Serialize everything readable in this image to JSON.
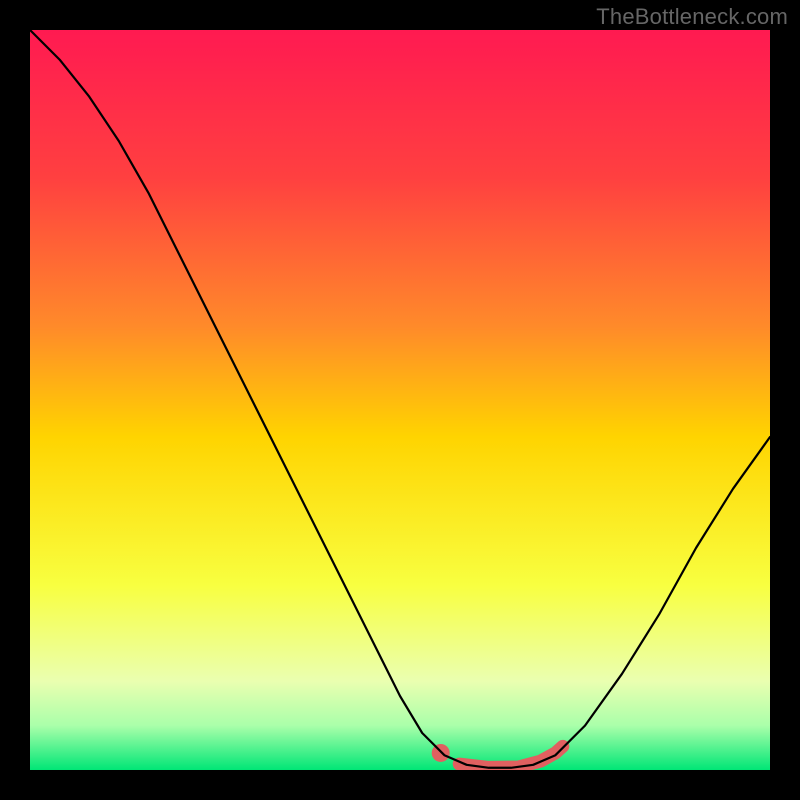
{
  "watermark": "TheBottleneck.com",
  "chart_data": {
    "type": "line",
    "title": "",
    "xlabel": "",
    "ylabel": "",
    "xlim": [
      0,
      100
    ],
    "ylim": [
      0,
      100
    ],
    "gradient_stops": [
      {
        "offset": 0,
        "color": "#ff1a51"
      },
      {
        "offset": 20,
        "color": "#ff4040"
      },
      {
        "offset": 40,
        "color": "#ff8a2a"
      },
      {
        "offset": 55,
        "color": "#ffd400"
      },
      {
        "offset": 75,
        "color": "#f8ff40"
      },
      {
        "offset": 88,
        "color": "#eaffb0"
      },
      {
        "offset": 94,
        "color": "#aaffaa"
      },
      {
        "offset": 100,
        "color": "#00e676"
      }
    ],
    "series": [
      {
        "name": "curve",
        "stroke": "#000000",
        "stroke_width": 2.2,
        "points": [
          {
            "x": 0,
            "y": 100
          },
          {
            "x": 4,
            "y": 96
          },
          {
            "x": 8,
            "y": 91
          },
          {
            "x": 12,
            "y": 85
          },
          {
            "x": 16,
            "y": 78
          },
          {
            "x": 20,
            "y": 70
          },
          {
            "x": 25,
            "y": 60
          },
          {
            "x": 30,
            "y": 50
          },
          {
            "x": 35,
            "y": 40
          },
          {
            "x": 40,
            "y": 30
          },
          {
            "x": 45,
            "y": 20
          },
          {
            "x": 50,
            "y": 10
          },
          {
            "x": 53,
            "y": 5
          },
          {
            "x": 56,
            "y": 2
          },
          {
            "x": 59,
            "y": 0.7
          },
          {
            "x": 62,
            "y": 0.3
          },
          {
            "x": 65,
            "y": 0.3
          },
          {
            "x": 68,
            "y": 0.7
          },
          {
            "x": 71,
            "y": 2
          },
          {
            "x": 75,
            "y": 6
          },
          {
            "x": 80,
            "y": 13
          },
          {
            "x": 85,
            "y": 21
          },
          {
            "x": 90,
            "y": 30
          },
          {
            "x": 95,
            "y": 38
          },
          {
            "x": 100,
            "y": 45
          }
        ]
      }
    ],
    "highlight": {
      "stroke": "#e06060",
      "stroke_width": 13,
      "dot_r": 9,
      "dot": {
        "x": 55.5,
        "y": 2.3
      },
      "segment": [
        {
          "x": 58,
          "y": 0.8
        },
        {
          "x": 62,
          "y": 0.35
        },
        {
          "x": 66,
          "y": 0.4
        },
        {
          "x": 69,
          "y": 1.2
        },
        {
          "x": 71,
          "y": 2.3
        },
        {
          "x": 72,
          "y": 3.2
        }
      ]
    }
  }
}
